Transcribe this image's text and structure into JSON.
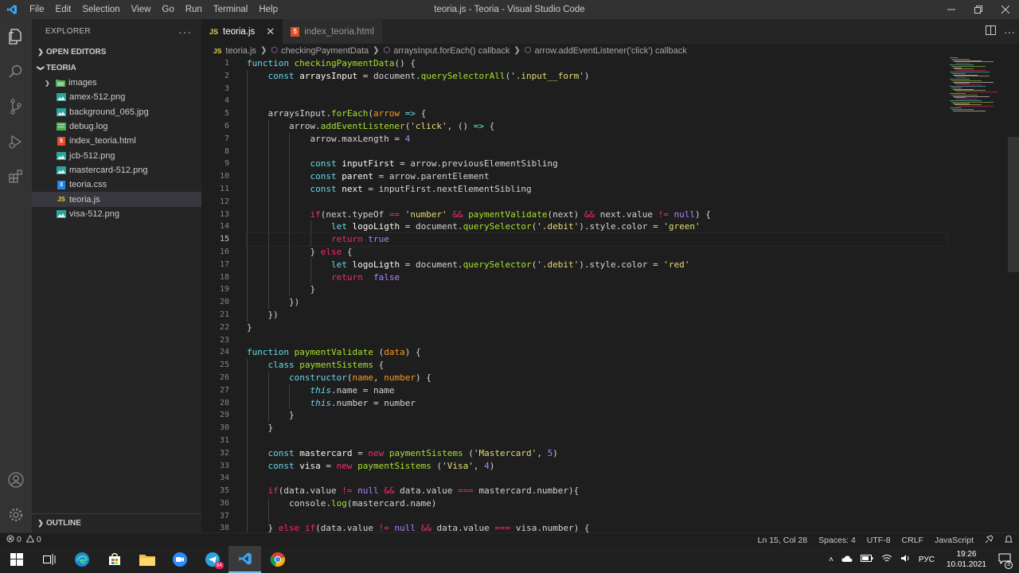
{
  "titlebar": {
    "menu": [
      "File",
      "Edit",
      "Selection",
      "View",
      "Go",
      "Run",
      "Terminal",
      "Help"
    ],
    "title": "teoria.js - Teoria - Visual Studio Code"
  },
  "sidebar": {
    "header": "EXPLORER",
    "open_editors": "OPEN EDITORS",
    "folder": "TEORIA",
    "items": [
      {
        "label": "images",
        "type": "folder"
      },
      {
        "label": "amex-512.png",
        "type": "image"
      },
      {
        "label": "background_065.jpg",
        "type": "image"
      },
      {
        "label": "debug.log",
        "type": "log"
      },
      {
        "label": "index_teoria.html",
        "type": "html"
      },
      {
        "label": "jcb-512.png",
        "type": "image"
      },
      {
        "label": "mastercard-512.png",
        "type": "image"
      },
      {
        "label": "teoria.css",
        "type": "css"
      },
      {
        "label": "teoria.js",
        "type": "js",
        "active": true
      },
      {
        "label": "visa-512.png",
        "type": "image"
      }
    ],
    "outline": "OUTLINE"
  },
  "tabs": [
    {
      "label": "teoria.js",
      "active": true,
      "icon": "JS"
    },
    {
      "label": "index_teoria.html",
      "active": false,
      "icon": "5"
    }
  ],
  "breadcrumb": {
    "file": "teoria.js",
    "items": [
      "checkingPaymentData",
      "arraysInput.forEach() callback",
      "arrow.addEventListener('click') callback"
    ]
  },
  "editor": {
    "current_line": 15,
    "start_line": 1
  },
  "statusbar": {
    "errors": "0",
    "warnings": "0",
    "position": "Ln 15, Col 28",
    "spaces": "Spaces: 4",
    "encoding": "UTF-8",
    "eol": "CRLF",
    "language": "JavaScript"
  },
  "taskbar": {
    "telegram_badge": "94",
    "lang": "РУС",
    "time": "19:26",
    "date": "10.01.2021",
    "notifications": "3"
  }
}
